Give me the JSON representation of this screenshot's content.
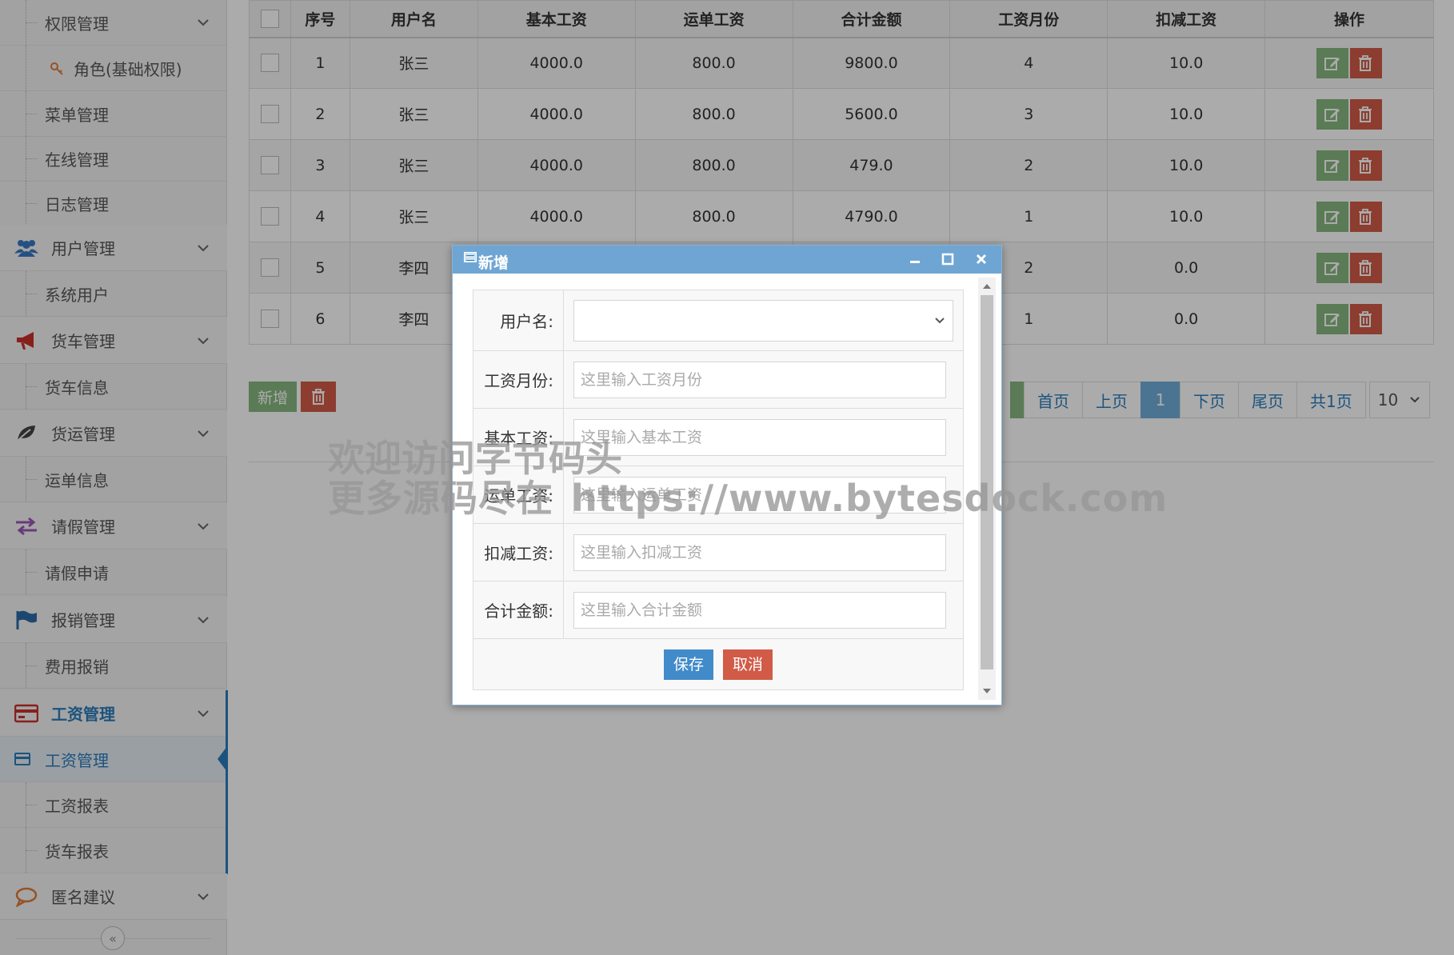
{
  "sidebar": {
    "items": [
      {
        "kind": "sub",
        "label": "权限管理",
        "chevron": true
      },
      {
        "kind": "sub3",
        "label": "角色(基础权限)",
        "icon": "key-icon"
      },
      {
        "kind": "sub",
        "label": "菜单管理"
      },
      {
        "kind": "sub",
        "label": "在线管理"
      },
      {
        "kind": "sub",
        "label": "日志管理"
      },
      {
        "kind": "group",
        "label": "用户管理",
        "icon": "users-icon"
      },
      {
        "kind": "sub",
        "label": "系统用户"
      },
      {
        "kind": "group",
        "label": "货车管理",
        "icon": "megaphone-icon"
      },
      {
        "kind": "sub",
        "label": "货车信息"
      },
      {
        "kind": "group",
        "label": "货运管理",
        "icon": "leaf-icon"
      },
      {
        "kind": "sub",
        "label": "运单信息"
      },
      {
        "kind": "group",
        "label": "请假管理",
        "icon": "exchange-icon"
      },
      {
        "kind": "sub",
        "label": "请假申请"
      },
      {
        "kind": "group",
        "label": "报销管理",
        "icon": "flag-icon"
      },
      {
        "kind": "sub",
        "label": "费用报销"
      },
      {
        "kind": "group",
        "label": "工资管理",
        "icon": "credit-card-icon",
        "active": true
      },
      {
        "kind": "sub",
        "label": "工资管理",
        "icon": "credit-card-icon",
        "active": true
      },
      {
        "kind": "sub",
        "label": "工资报表"
      },
      {
        "kind": "sub",
        "label": "货车报表"
      },
      {
        "kind": "group",
        "label": "匿名建议",
        "icon": "comment-icon"
      }
    ],
    "collapse_icon": "double-chevron-left-icon"
  },
  "table": {
    "columns": [
      "序号",
      "用户名",
      "基本工资",
      "运单工资",
      "合计金额",
      "工资月份",
      "扣减工资",
      "操作"
    ],
    "rows": [
      {
        "no": "1",
        "user": "张三",
        "base": "4000.0",
        "waybill": "800.0",
        "total": "9800.0",
        "month": "4",
        "deduct": "10.0"
      },
      {
        "no": "2",
        "user": "张三",
        "base": "4000.0",
        "waybill": "800.0",
        "total": "5600.0",
        "month": "3",
        "deduct": "10.0"
      },
      {
        "no": "3",
        "user": "张三",
        "base": "4000.0",
        "waybill": "800.0",
        "total": "479.0",
        "month": "2",
        "deduct": "10.0"
      },
      {
        "no": "4",
        "user": "张三",
        "base": "4000.0",
        "waybill": "800.0",
        "total": "4790.0",
        "month": "1",
        "deduct": "10.0"
      },
      {
        "no": "5",
        "user": "李四",
        "base": "",
        "waybill": "",
        "total": "",
        "month": "2",
        "deduct": "0.0"
      },
      {
        "no": "6",
        "user": "李四",
        "base": "",
        "waybill": "",
        "total": "",
        "month": "1",
        "deduct": "0.0"
      }
    ]
  },
  "toolbar": {
    "add_label": "新增",
    "batch_delete_icon": "trash-icon"
  },
  "pager": {
    "first": "首页",
    "prev": "上页",
    "current": "1",
    "next": "下页",
    "last": "尾页",
    "total": "共1页",
    "page_size": "10"
  },
  "watermark": {
    "line1": "欢迎访问字节码头",
    "line2": "更多源码尽在",
    "url": "https://www.bytesdock.com"
  },
  "dialog": {
    "title": "新增",
    "fields": {
      "user": {
        "label": "用户名:",
        "value": ""
      },
      "month": {
        "label": "工资月份:",
        "placeholder": "这里输入工资月份"
      },
      "base": {
        "label": "基本工资:",
        "placeholder": "这里输入基本工资"
      },
      "waybill": {
        "label": "运单工资:",
        "placeholder": "这里输入运单工资"
      },
      "deduct": {
        "label": "扣减工资:",
        "placeholder": "这里输入扣减工资"
      },
      "total": {
        "label": "合计金额:",
        "placeholder": "这里输入合计金额"
      }
    },
    "save_label": "保存",
    "cancel_label": "取消"
  },
  "colors": {
    "accent": "#2b7dbc",
    "success": "#87b87f",
    "danger": "#d15b47",
    "primary": "#428bca",
    "dialog_header": "#6fa5d3"
  }
}
